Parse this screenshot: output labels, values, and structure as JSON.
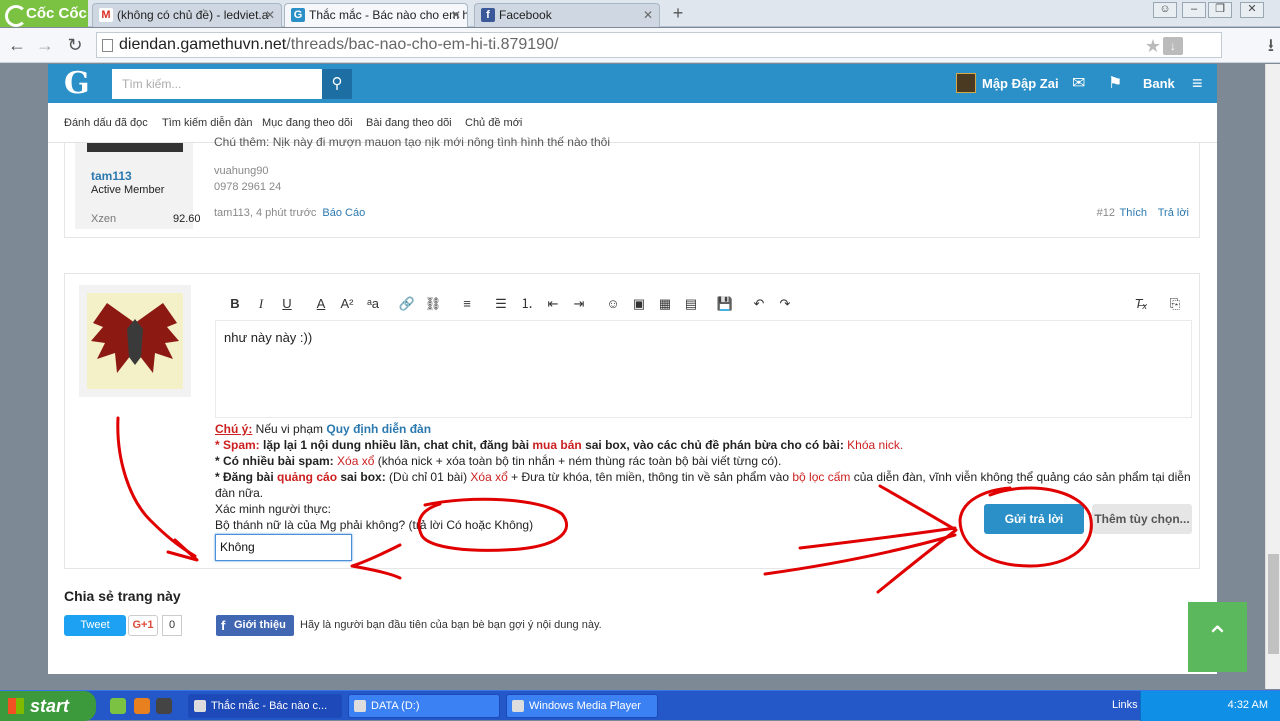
{
  "browser": {
    "brand": "Cốc Cốc",
    "tabs": [
      {
        "label": "(không có chủ đề) - ledviet.a",
        "icon": "gmail-icon"
      },
      {
        "label": "Thắc mắc - Bác nào cho em hỏi",
        "icon": "gamethu-icon"
      },
      {
        "label": "Facebook",
        "icon": "facebook-icon"
      }
    ],
    "url_host": "diendan.gamethuvn.net",
    "url_path": "/threads/bac-nao-cho-em-hi-ti.879190/"
  },
  "header": {
    "logo": "G",
    "search_placeholder": "Tìm kiếm...",
    "username": "Mập Đập Zai",
    "bank": "Bank"
  },
  "subnav": [
    "Đánh dấu đã đọc",
    "Tìm kiếm diễn đàn",
    "Mục đang theo dõi",
    "Bài đang theo dõi",
    "Chủ đề mới"
  ],
  "prev_post": {
    "username": "tam113",
    "role": "Active Member",
    "xzen_label": "Xzen",
    "xzen_value": "92.60",
    "cut_text": "Chú thêm: Nịk này đi mượn mauon tạo nịk mới nông tình hình thế nào thôi",
    "signature_line1": "vuahung90",
    "signature_line2": "0978 2961 24",
    "meta": "tam113, 4 phút trước",
    "report": "Báo Cáo",
    "post_number": "#12",
    "like": "Thích",
    "reply": "Trả lời"
  },
  "editor": {
    "content": "như này này :))"
  },
  "rules": {
    "note_label": "Chú ý:",
    "note_text": " Nếu vi phạm ",
    "note_link": "Quy định diễn đàn",
    "spam_label": "* Spam:",
    "spam_text": " lặp lại 1 nội dung nhiều lần, chat chit, đăng bài ",
    "spam_red": "mua bán",
    "spam_text2": " sai box, vào các chủ đề phán bừa cho có bài: ",
    "spam_penalty": "Khóa nick.",
    "many_label": "* Có nhiều bài spam:",
    "many_red": " Xóa xổ",
    "many_text": " (khóa nick + xóa toàn bộ tin nhắn + ném thùng rác toàn bộ bài viết từng có).",
    "ads_label": "* Đăng bài ",
    "ads_red": "quảng cáo",
    "ads_label2": " sai box:",
    "ads_text": " (Dù chỉ 01 bài) ",
    "ads_red2": "Xóa xổ",
    "ads_text2": " + Đưa từ khóa, tên miền, thông tin về sản phẩm vào ",
    "ads_red3": "bộ lọc cấm",
    "ads_text3": " của diễn đàn, vĩnh viễn không thể quảng cáo sản phẩm tại diễn đàn nữa.",
    "verify": "Xác minh người thực:",
    "question": "Bộ thánh nữ là của Mg phải không? (trả lời Có hoặc Không)"
  },
  "answer_value": "Không",
  "buttons": {
    "send": "Gửi trả lời",
    "more": "Thêm tùy chọn..."
  },
  "share": {
    "title": "Chia sẻ trang này",
    "tweet": "Tweet",
    "gplus": "G+1",
    "gcount": "0",
    "fb": "Giới thiệu",
    "fb_text": "Hãy là người bạn đầu tiên của bạn bè bạn gợi ý nội dung này."
  },
  "taskbar": {
    "start": "start",
    "tasks": [
      "Thắc mắc - Bác nào c...",
      "DATA (D:)",
      "Windows Media Player"
    ],
    "links": "Links",
    "clock": "4:32 AM"
  },
  "colors": {
    "header_blue": "#2c90c8",
    "annotation_red": "#e00000",
    "alert_red": "#cc1f1f"
  }
}
